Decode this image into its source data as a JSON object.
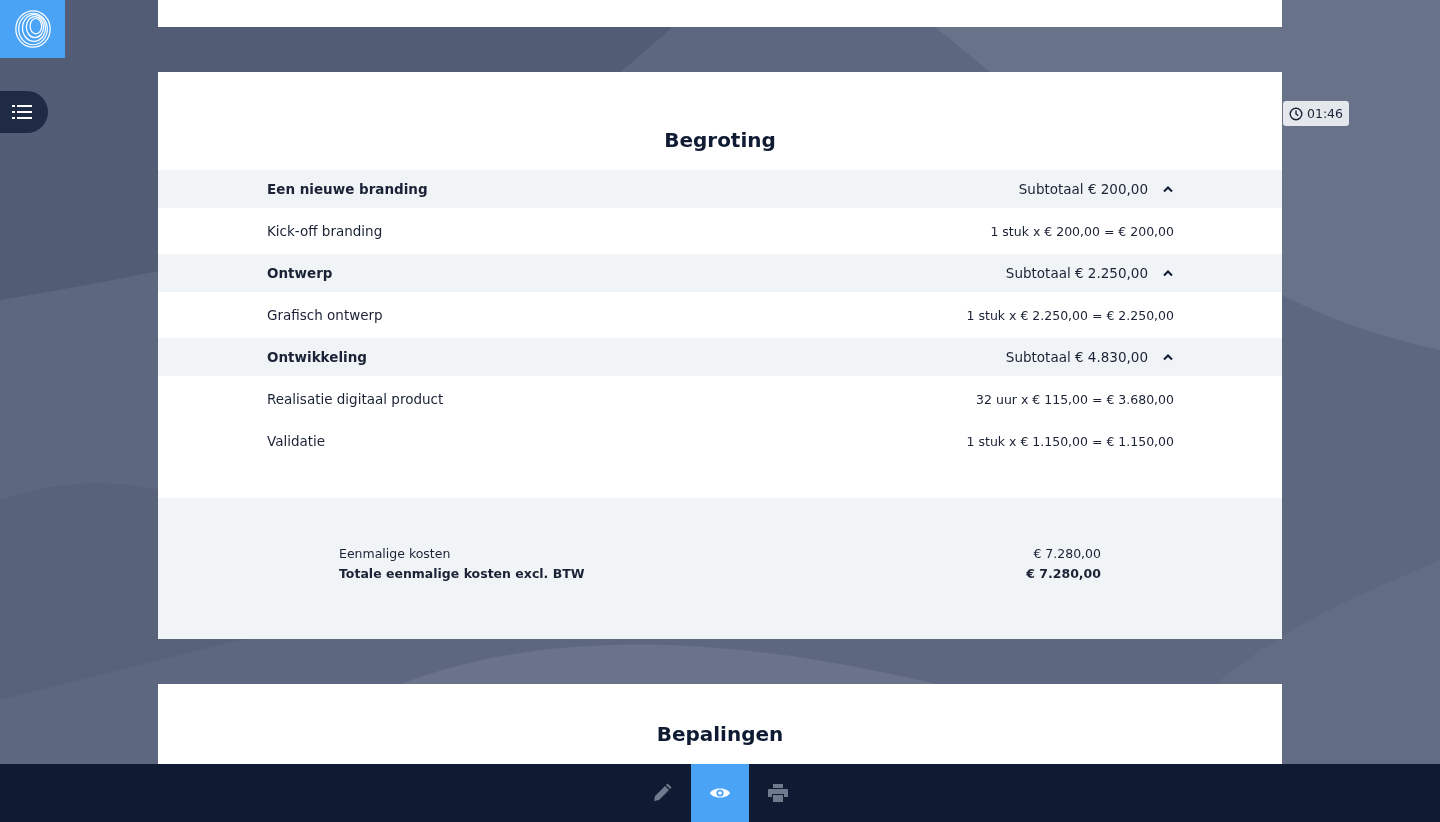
{
  "timer": {
    "time": "01:46"
  },
  "budget": {
    "title": "Begroting",
    "groups": [
      {
        "name": "Een nieuwe branding",
        "subtotal": "Subtotaal € 200,00",
        "expanded": true,
        "items": [
          {
            "name": "Kick-off branding",
            "calc": "1 stuk x € 200,00 = € 200,00"
          }
        ]
      },
      {
        "name": "Ontwerp",
        "subtotal": "Subtotaal € 2.250,00",
        "expanded": true,
        "items": [
          {
            "name": "Grafisch ontwerp",
            "calc": "1 stuk x € 2.250,00 = € 2.250,00"
          }
        ]
      },
      {
        "name": "Ontwikkeling",
        "subtotal": "Subtotaal € 4.830,00",
        "expanded": true,
        "items": [
          {
            "name": "Realisatie digitaal product",
            "calc": "32 uur x € 115,00 = € 3.680,00"
          },
          {
            "name": "Validatie",
            "calc": "1 stuk x € 1.150,00 = € 1.150,00"
          }
        ]
      }
    ],
    "totals": [
      {
        "kind": "regular",
        "label": "Eenmalige kosten",
        "value": "€ 7.280,00"
      },
      {
        "kind": "total",
        "label": "Totale eenmalige kosten excl. BTW",
        "value": "€ 7.280,00"
      }
    ]
  },
  "next_section": {
    "title": "Bepalingen"
  },
  "toolbar": [
    {
      "kind": "edit",
      "selected": false
    },
    {
      "kind": "preview",
      "selected": true
    },
    {
      "kind": "print",
      "selected": false
    }
  ]
}
